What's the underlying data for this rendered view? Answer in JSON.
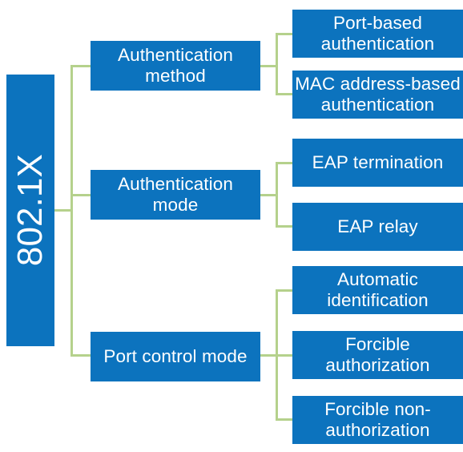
{
  "diagram": {
    "title": "802.1X",
    "type": "hierarchy-tree",
    "colors": {
      "node_fill": "#0c73be",
      "node_text": "#ffffff",
      "connector": "#b5d18c",
      "background": "#ffffff"
    },
    "root": {
      "label": "802.1X",
      "orientation": "vertical-rotated"
    },
    "branches": [
      {
        "label": "Authentication method",
        "children": [
          {
            "label": "Port-based authentication"
          },
          {
            "label": "MAC address-based authentication"
          }
        ]
      },
      {
        "label": "Authentication mode",
        "children": [
          {
            "label": "EAP termination"
          },
          {
            "label": "EAP relay"
          }
        ]
      },
      {
        "label": "Port control mode",
        "children": [
          {
            "label": "Automatic identification"
          },
          {
            "label": "Forcible authorization"
          },
          {
            "label": "Forcible non-authorization"
          }
        ]
      }
    ]
  }
}
